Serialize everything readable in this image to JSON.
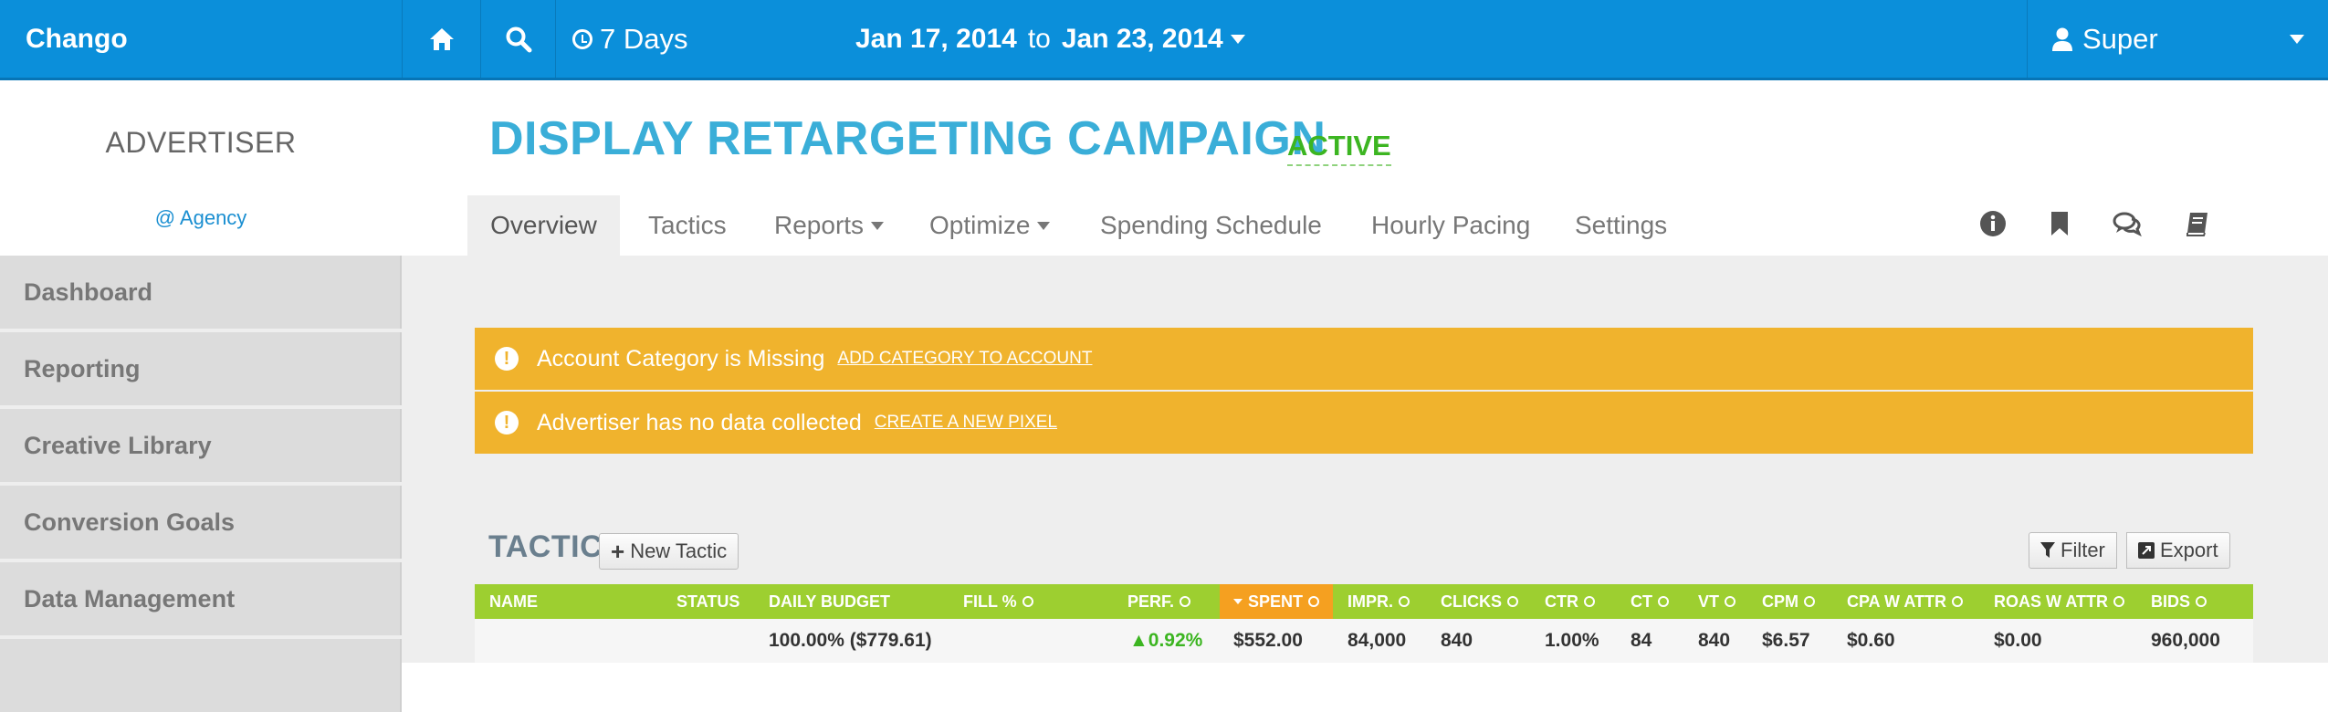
{
  "topbar": {
    "brand": "Chango",
    "range_label": "7 Days",
    "date_start": "Jan 17, 2014",
    "date_to": "to",
    "date_end": "Jan 23, 2014",
    "user": "Super"
  },
  "sidebar": {
    "title": "ADVERTISER",
    "agency": "@ Agency",
    "items": [
      {
        "label": "Dashboard"
      },
      {
        "label": "Reporting"
      },
      {
        "label": "Creative Library"
      },
      {
        "label": "Conversion Goals"
      },
      {
        "label": "Data Management"
      }
    ]
  },
  "campaign": {
    "title": "DISPLAY RETARGETING CAMPAIGN",
    "status": "ACTIVE"
  },
  "tabs": [
    {
      "label": "Overview"
    },
    {
      "label": "Tactics"
    },
    {
      "label": "Reports"
    },
    {
      "label": "Optimize"
    },
    {
      "label": "Spending Schedule"
    },
    {
      "label": "Hourly Pacing"
    },
    {
      "label": "Settings"
    }
  ],
  "toolbar_icons": [
    "info-icon",
    "bookmark-icon",
    "comments-icon",
    "book-icon"
  ],
  "alerts": [
    {
      "message": "Account Category is Missing",
      "link": "ADD CATEGORY TO ACCOUNT"
    },
    {
      "message": "Advertiser has no data collected",
      "link": "CREATE A NEW PIXEL"
    }
  ],
  "tactics": {
    "title": "TACTICS",
    "new_button": "New Tactic",
    "filter_button": "Filter",
    "export_button": "Export",
    "columns": [
      "NAME",
      "STATUS",
      "DAILY BUDGET",
      "FILL %",
      "PERF.",
      "SPENT",
      "IMPR.",
      "CLICKS",
      "CTR",
      "CT",
      "VT",
      "CPM",
      "CPA W ATTR",
      "ROAS W ATTR",
      "BIDS"
    ],
    "summary_row": {
      "daily_budget": "100.00% ($779.61)",
      "perf": "0.92%",
      "spent": "$552.00",
      "impr": "84,000",
      "clicks": "840",
      "ctr": "1.00%",
      "ct": "84",
      "vt": "840",
      "cpm": "$6.57",
      "cpa": "$0.60",
      "roas": "$0.00",
      "bids": "960,000"
    }
  },
  "colors": {
    "topbar": "#0b8fda",
    "title": "#3aaed8",
    "active": "#3cb521",
    "alert": "#f0b32d",
    "table_header": "#9dcf30",
    "sorted_header": "#f5a020"
  }
}
